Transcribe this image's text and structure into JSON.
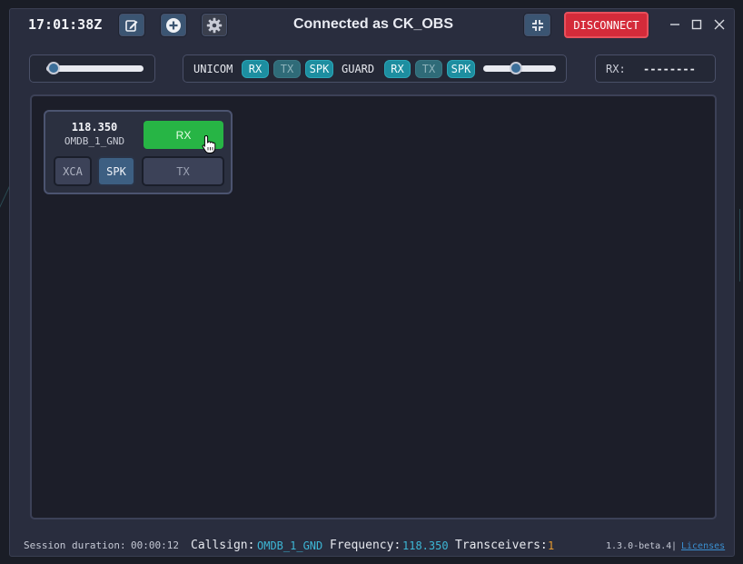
{
  "header": {
    "clock": "17:01:38Z",
    "title": "Connected as CK_OBS",
    "disconnect_label": "DISCONNECT"
  },
  "icons": {
    "edit": "edit-icon",
    "add": "add-circle-icon",
    "settings": "gear-icon",
    "collapse": "collapse-icon",
    "minimize": "minimize-icon",
    "maximize": "maximize-icon",
    "close": "close-icon"
  },
  "controls": {
    "main_volume_level": 0.18,
    "unicom_label": "UNICOM",
    "unicom": {
      "rx": "RX",
      "tx": "TX",
      "spk": "SPK",
      "rx_on": true,
      "tx_on": false,
      "spk_on": true
    },
    "guard_label": "GUARD",
    "guard": {
      "rx": "RX",
      "tx": "TX",
      "spk": "SPK",
      "rx_on": true,
      "tx_on": false,
      "spk_on": true
    },
    "guard_volume_level": 0.5,
    "rx_label": "RX:",
    "rx_value": "--------"
  },
  "transceiver": {
    "frequency": "118.350",
    "callsign": "OMDB_1_GND",
    "rx_label": "RX",
    "xca_label": "XCA",
    "spk_label": "SPK",
    "tx_label": "TX"
  },
  "status": {
    "session_label": "Session duration:",
    "session_value": "00:00:12",
    "callsign_label": "Callsign:",
    "callsign_value": "OMDB_1_GND",
    "frequency_label": "Frequency:",
    "frequency_value": "118.350",
    "transceivers_label": "Transceivers:",
    "transceivers_value": "1",
    "version": "1.3.0-beta.4",
    "separator": "|",
    "licenses_label": "Licenses"
  },
  "colors": {
    "accent_teal": "#1d8ea0",
    "rx_active": "#27b545",
    "disconnect": "#d42b3a",
    "callsign_value": "#3db7d6",
    "transceivers_value": "#e89a2f"
  }
}
